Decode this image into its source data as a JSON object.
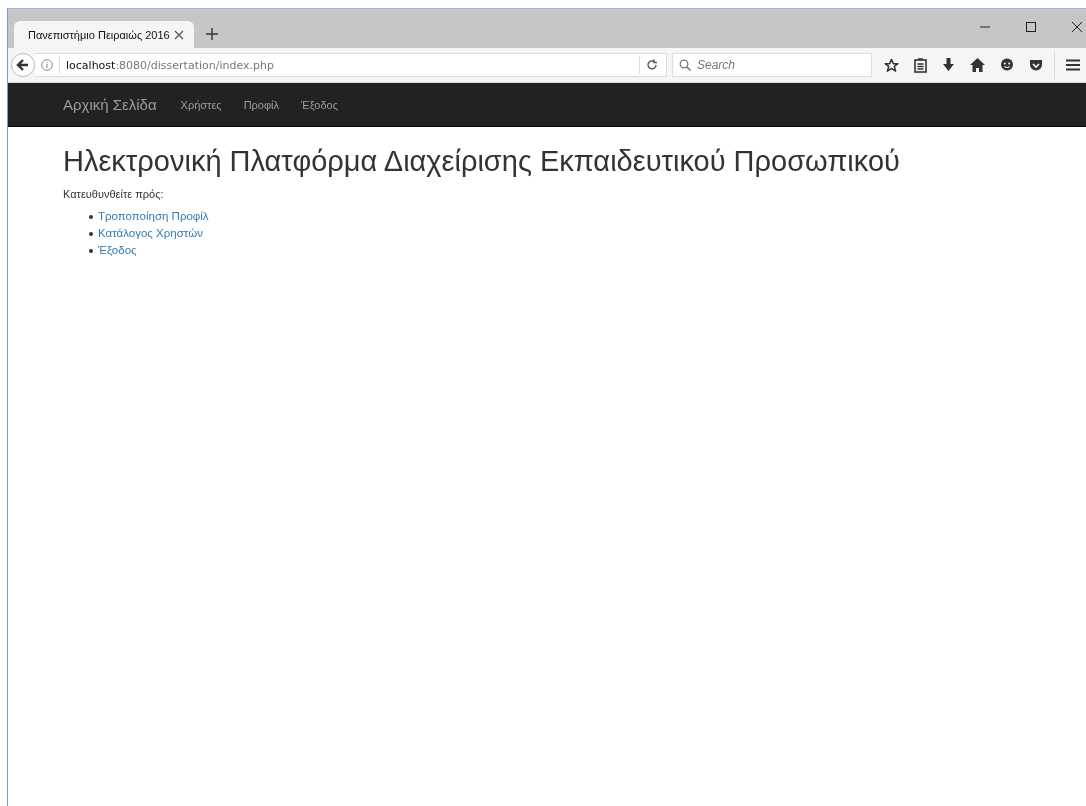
{
  "browser": {
    "tab": {
      "title": "Πανεπιστήμιο Πειραιώς 2016",
      "selected": true
    },
    "url": {
      "host": "localhost",
      "path": ":8080/dissertation/index.php"
    },
    "search": {
      "placeholder": "Search"
    }
  },
  "navbar": {
    "brand": "Αρχική Σελίδα",
    "links": [
      "Χρήστες",
      "Προφίλ",
      "Έξοδος"
    ]
  },
  "page": {
    "heading": "Ηλεκτρονική Πλατφόρμα Διαχείρισης Εκπαιδευτικού Προσωπικού",
    "intro": "Κατευθυνθείτε πρός:",
    "links": [
      "Τροποποίηση Προφίλ",
      "Κατάλογος Χρηστών",
      "Έξοδος"
    ]
  }
}
